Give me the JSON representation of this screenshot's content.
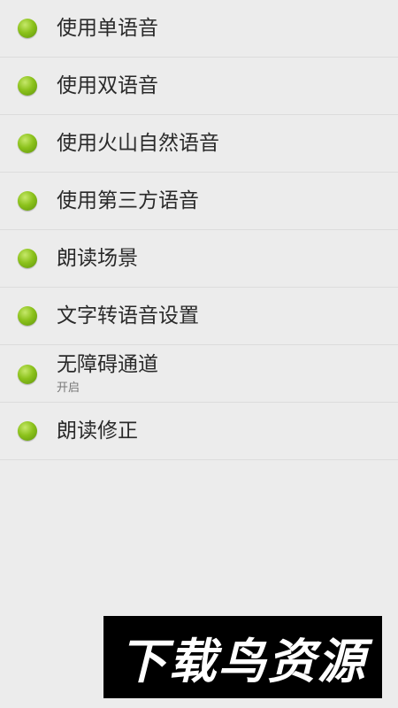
{
  "settings_list": {
    "items": [
      {
        "label": "使用单语音",
        "subtitle": ""
      },
      {
        "label": "使用双语音",
        "subtitle": ""
      },
      {
        "label": "使用火山自然语音",
        "subtitle": ""
      },
      {
        "label": "使用第三方语音",
        "subtitle": ""
      },
      {
        "label": "朗读场景",
        "subtitle": ""
      },
      {
        "label": "文字转语音设置",
        "subtitle": ""
      },
      {
        "label": "无障碍通道",
        "subtitle": "开启"
      },
      {
        "label": "朗读修正",
        "subtitle": ""
      }
    ]
  },
  "watermark": {
    "text": "下载鸟资源"
  },
  "colors": {
    "background": "#ececec",
    "bullet": "#8cc21c",
    "divider": "#dcdcdc",
    "title_text": "#2a2a2a",
    "subtitle_text": "#777777",
    "watermark_bg": "#000000",
    "watermark_text": "#ffffff"
  }
}
